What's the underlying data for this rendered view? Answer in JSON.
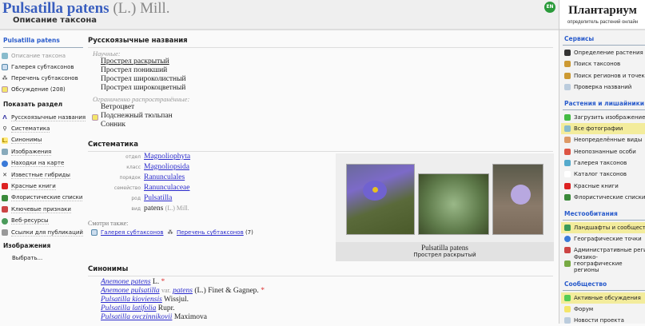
{
  "header": {
    "title": "Pulsatilla patens",
    "author": "(L.) Mill.",
    "subtitle": "Описание таксона",
    "lang": "EN"
  },
  "left": {
    "taxon": "Pulsatilla patens",
    "actions": [
      "Описание таксона",
      "Галерея субтаксонов",
      "Перечень субтаксонов",
      "Обсуждение (208)"
    ],
    "sections_title": "Показать раздел",
    "sections": [
      "Русскоязычные названия",
      "Систематика",
      "Синонимы",
      "Изображения",
      "Находки на карте",
      "Известные гибриды",
      "Красные книги",
      "Флористические списки",
      "Ключевые признаки",
      "Веб-ресурсы",
      "Ссылки для публикаций"
    ],
    "images_title": "Изображения",
    "images_choose": "Выбрать..."
  },
  "main": {
    "ru_title": "Русскоязычные названия",
    "sci_label": "Научные:",
    "sci_names": [
      "Прострел раскрытый",
      "Прострел поникший",
      "Прострел широколистный",
      "Прострел широкоцветный"
    ],
    "lim_label": "Ограниченно распространённые:",
    "lim_names": [
      "Ветроцвет",
      "Подснежный тюльпан",
      "Сонник"
    ],
    "syst_title": "Систематика",
    "syst": [
      {
        "rank": "отдел",
        "name": "Magnoliophyta"
      },
      {
        "rank": "класс",
        "name": "Magnoliopsida"
      },
      {
        "rank": "порядок",
        "name": "Ranunculales"
      },
      {
        "rank": "семейство",
        "name": "Ranunculaceae"
      },
      {
        "rank": "род",
        "name": "Pulsatilla"
      }
    ],
    "species": {
      "rank": "вид",
      "name": "patens",
      "author": "(L.) Mill."
    },
    "see_also": "Смотри также:",
    "see_gallery": "Галерея субтаксонов",
    "see_list": "Перечень субтаксонов",
    "see_count": "(7)",
    "gallery_caption_latin": "Pulsatilla patens",
    "gallery_caption_ru": "Прострел раскрытый",
    "syn_title": "Синонимы",
    "synonyms": [
      {
        "a": "Anemone patens",
        "b": "",
        "c": "",
        "auth": "L.",
        "star": "*"
      },
      {
        "a": "Anemone pulsatilla",
        "b": "var.",
        "c": "patens",
        "auth": "(L.) Finet & Gagnep.",
        "star": "*"
      },
      {
        "a": "Pulsatilla kioviensis",
        "b": "",
        "c": "",
        "auth": "Wissjul.",
        "star": ""
      },
      {
        "a": "Pulsatilla latifolia",
        "b": "",
        "c": "",
        "auth": "Rupr.",
        "star": ""
      },
      {
        "a": "Pulsatilla ovczinnikovii",
        "b": "",
        "c": "",
        "auth": "Maximova",
        "star": ""
      }
    ]
  },
  "right": {
    "logo": "Плантариум",
    "logo_sub": "определитель растений онлайн",
    "sections": [
      {
        "title": "Сервисы",
        "items": [
          "Определение растения",
          "Поиск таксонов",
          "Поиск регионов и точек",
          "Проверка названий"
        ]
      },
      {
        "title": "Растения и лишайники",
        "items": [
          "Загрузить изображение",
          "Все фотографии",
          "Неопределённые виды",
          "Неопознанные особи",
          "Галерея таксонов",
          "Каталог таксонов",
          "Красные книги",
          "Флористические списки"
        ]
      },
      {
        "title": "Местообитания",
        "items": [
          "Ландшафты и сообщества",
          "Географические точки",
          "Административные регионы",
          "Физико-географические регионы"
        ]
      },
      {
        "title": "Сообщество",
        "items": [
          "Активные обсуждения",
          "Форум",
          "Новости проекта"
        ]
      }
    ]
  },
  "colors": {
    "link": "#2a2acc",
    "heading": "#2a5ccc",
    "highlight": "#f3ec9c",
    "en_badge": "#2a9a3a"
  }
}
